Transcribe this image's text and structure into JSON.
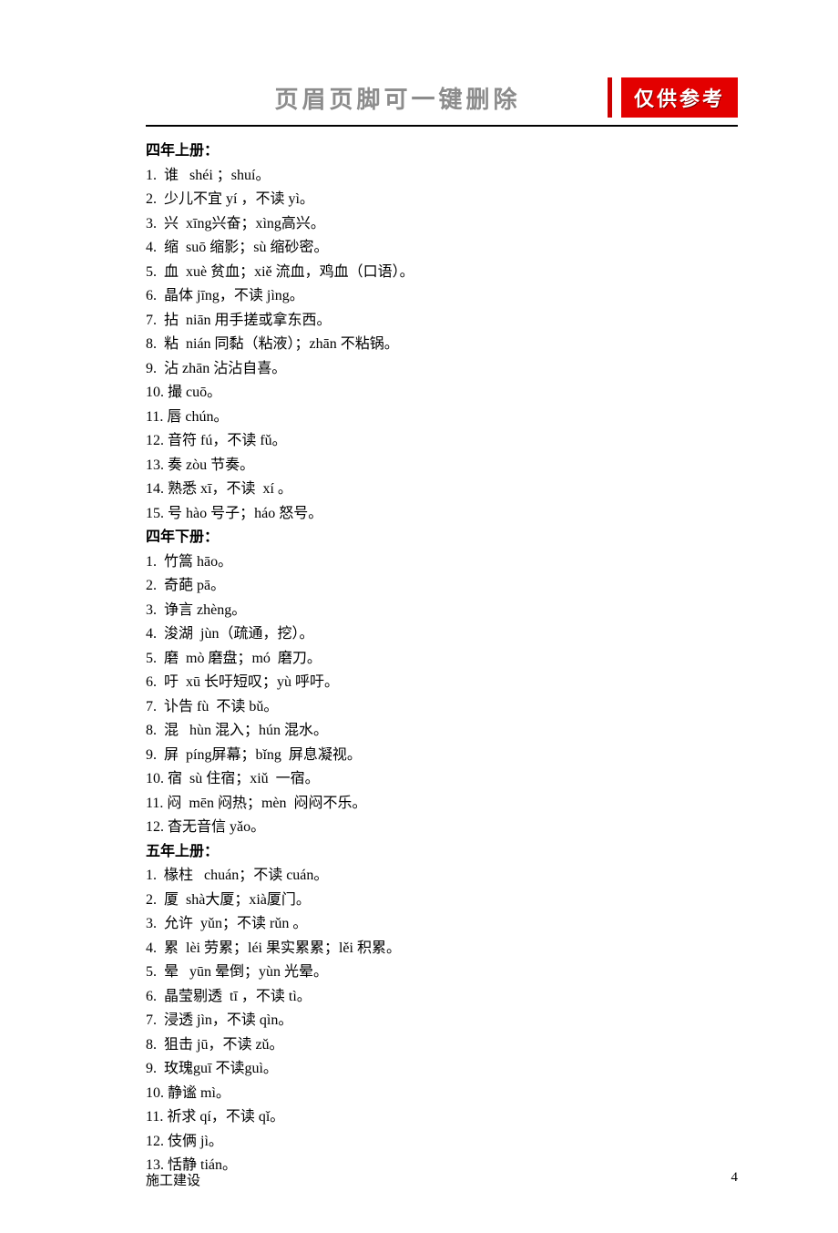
{
  "header": {
    "title": "页眉页脚可一键删除",
    "badge": "仅供参考"
  },
  "sections": [
    {
      "title": "四年上册：",
      "items": [
        "1.  谁   shéi ；shuí。",
        "2.  少儿不宜 yí ，不读 yì。",
        "3.  兴  xīng兴奋；xìng高兴。",
        "4.  缩  suō 缩影；sù 缩砂密。",
        "5.  血  xuè 贫血；xiě 流血，鸡血（口语）。",
        "6.  晶体 jīng，不读 jìng。",
        "7.  拈  niān 用手搓或拿东西。",
        "8.  粘  nián 同黏（粘液）；zhān 不粘锅。",
        "9.  沾 zhān 沾沾自喜。",
        "10. 撮 cuō。",
        "11. 唇 chún。",
        "12. 音符 fú，不读 fǔ。",
        "13. 奏 zòu 节奏。",
        "14. 熟悉 xī，不读  xí 。",
        "15. 号 hào 号子；háo 怒号。"
      ]
    },
    {
      "title": "四年下册：",
      "items": [
        "1.  竹篙 hāo。",
        "2.  奇葩 pā。",
        "3.  诤言 zhèng。",
        "4.  浚湖  jùn（疏通，挖）。",
        "5.  磨  mò 磨盘；mó  磨刀。",
        "6.  吁  xū 长吁短叹；yù 呼吁。",
        "7.  讣告 fù  不读 bǔ。",
        "8.  混   hùn 混入；hún 混水。",
        "9.  屏  píng屏幕；bǐng  屏息凝视。",
        "10. 宿  sù 住宿；xiǔ  一宿。",
        "11. 闷  mēn 闷热；mèn  闷闷不乐。",
        "12. 杳无音信 yǎo。"
      ]
    },
    {
      "title": "五年上册：",
      "items": [
        "1.  椽柱   chuán；不读 cuán。",
        "2.  厦  shà大厦；xià厦门。",
        "3.  允许  yǔn；不读 rǔn 。",
        "4.  累  lèi 劳累；léi 果实累累；lěi 积累。",
        "5.  晕   yūn 晕倒；yùn 光晕。",
        "6.  晶莹剔透  tī ，不读 tì。",
        "7.  浸透 jìn，不读 qìn。",
        "8.  狙击 jū，不读 zǔ。",
        "9.  玫瑰guī 不读guì。",
        "10. 静谧 mì。",
        "11. 祈求 qí，不读 qǐ。",
        "12. 伎俩 jì。",
        "13. 恬静 tián。"
      ]
    }
  ],
  "footer": {
    "left": "施工建设",
    "page": "4"
  }
}
